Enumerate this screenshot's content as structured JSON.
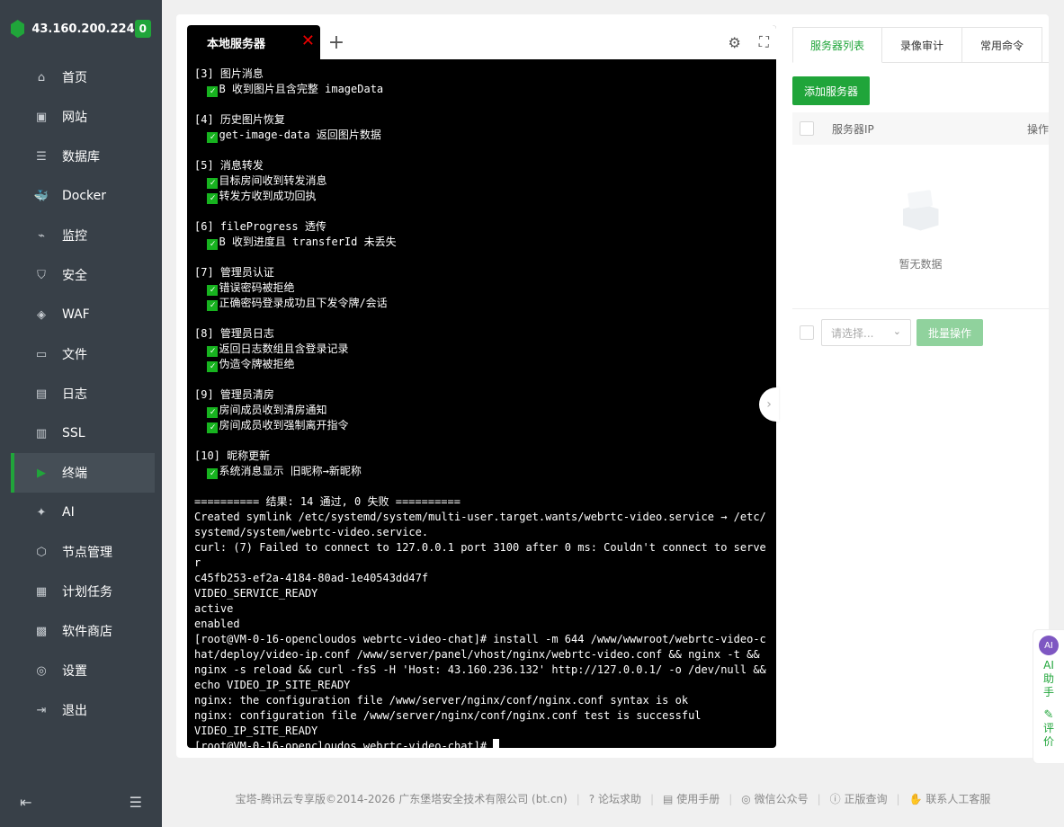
{
  "sidebar": {
    "server_ip": "43.160.200.224",
    "badge": "0",
    "items": [
      {
        "label": "首页",
        "icon": "home-icon"
      },
      {
        "label": "网站",
        "icon": "website-icon"
      },
      {
        "label": "数据库",
        "icon": "database-icon"
      },
      {
        "label": "Docker",
        "icon": "docker-icon"
      },
      {
        "label": "监控",
        "icon": "monitor-icon"
      },
      {
        "label": "安全",
        "icon": "security-icon"
      },
      {
        "label": "WAF",
        "icon": "waf-icon"
      },
      {
        "label": "文件",
        "icon": "folder-icon"
      },
      {
        "label": "日志",
        "icon": "log-icon"
      },
      {
        "label": "SSL",
        "icon": "ssl-icon"
      },
      {
        "label": "终端",
        "icon": "terminal-icon",
        "active": true
      },
      {
        "label": "AI",
        "icon": "ai-icon"
      },
      {
        "label": "节点管理",
        "icon": "node-icon"
      },
      {
        "label": "计划任务",
        "icon": "calendar-icon"
      },
      {
        "label": "软件商店",
        "icon": "store-icon"
      },
      {
        "label": "设置",
        "icon": "settings-icon"
      },
      {
        "label": "退出",
        "icon": "logout-icon"
      }
    ]
  },
  "terminal": {
    "tab_label": "本地服务器",
    "lines": [
      "[3] 图片消息",
      "  ✅B 收到图片且含完整 imageData",
      "",
      "[4] 历史图片恢复",
      "  ✅get-image-data 返回图片数据",
      "",
      "[5] 消息转发",
      "  ✅目标房间收到转发消息",
      "  ✅转发方收到成功回执",
      "",
      "[6] fileProgress 透传",
      "  ✅B 收到进度且 transferId 未丢失",
      "",
      "[7] 管理员认证",
      "  ✅错误密码被拒绝",
      "  ✅正确密码登录成功且下发令牌/会话",
      "",
      "[8] 管理员日志",
      "  ✅返回日志数组且含登录记录",
      "  ✅伪造令牌被拒绝",
      "",
      "[9] 管理员清房",
      "  ✅房间成员收到清房通知",
      "  ✅房间成员收到强制离开指令",
      "",
      "[10] 昵称更新",
      "  ✅系统消息显示 旧昵称→新昵称",
      "",
      "========== 结果: 14 通过, 0 失败 ==========",
      "Created symlink /etc/systemd/system/multi-user.target.wants/webrtc-video.service → /etc/systemd/system/webrtc-video.service.",
      "curl: (7) Failed to connect to 127.0.0.1 port 3100 after 0 ms: Couldn't connect to server",
      "c45fb253-ef2a-4184-80ad-1e40543dd47f",
      "VIDEO_SERVICE_READY",
      "active",
      "enabled",
      "[root@VM-0-16-opencloudos webrtc-video-chat]# install -m 644 /www/wwwroot/webrtc-video-chat/deploy/video-ip.conf /www/server/panel/vhost/nginx/webrtc-video.conf && nginx -t && nginx -s reload && curl -fsS -H 'Host: 43.160.236.132' http://127.0.0.1/ -o /dev/null && echo VIDEO_IP_SITE_READY",
      "nginx: the configuration file /www/server/nginx/conf/nginx.conf syntax is ok",
      "nginx: configuration file /www/server/nginx/conf/nginx.conf test is successful",
      "VIDEO_IP_SITE_READY",
      "[root@VM-0-16-opencloudos webrtc-video-chat]# "
    ]
  },
  "right_panel": {
    "tabs": [
      "服务器列表",
      "录像审计",
      "常用命令"
    ],
    "add_button": "添加服务器",
    "col_ip": "服务器IP",
    "col_op": "操作",
    "empty_text": "暂无数据",
    "select_placeholder": "请选择...",
    "batch_button": "批量操作"
  },
  "ai_widget": {
    "face": "AI",
    "label": "AI助手",
    "review": "评价"
  },
  "footer": {
    "copyright": "宝塔-腾讯云专享版©2014-2026 广东堡塔安全技术有限公司 (bt.cn)",
    "links": [
      "论坛求助",
      "使用手册",
      "微信公众号",
      "正版查询",
      "联系人工客服"
    ]
  }
}
